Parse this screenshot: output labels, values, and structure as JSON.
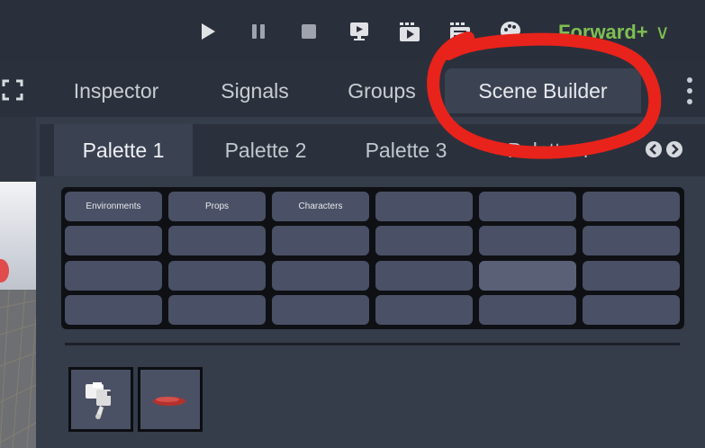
{
  "toolbar": {
    "buttons": [
      {
        "name": "play-icon"
      },
      {
        "name": "pause-icon"
      },
      {
        "name": "stop-icon"
      },
      {
        "name": "remote-debug-icon"
      },
      {
        "name": "play-scene-icon"
      },
      {
        "name": "play-custom-scene-icon"
      },
      {
        "name": "movie-maker-icon"
      }
    ],
    "renderer_label": "Forward+",
    "renderer_chevron": "∨"
  },
  "dock": {
    "tabs": [
      "Inspector",
      "Signals",
      "Groups",
      "Scene Builder"
    ],
    "active_tab": "Scene Builder"
  },
  "scene_builder": {
    "palette_tabs": [
      "Palette 1",
      "Palette 2",
      "Palette 3",
      "Palette 4"
    ],
    "active_palette": "Palette 1",
    "grid": [
      [
        "Environments",
        "Props",
        "Characters",
        "",
        "",
        ""
      ],
      [
        "",
        "",
        "",
        "",
        "",
        ""
      ],
      [
        "",
        "",
        "",
        "",
        "",
        ""
      ],
      [
        "",
        "",
        "",
        "",
        "",
        ""
      ]
    ],
    "thumbnails": [
      {
        "name": "robot-model-thumbnail"
      },
      {
        "name": "red-disc-model-thumbnail"
      }
    ]
  },
  "colors": {
    "accent_green": "#7fbf52",
    "annotation_red": "#e8231b",
    "cell": "#4a5166",
    "tab_active": "#3b4252"
  }
}
